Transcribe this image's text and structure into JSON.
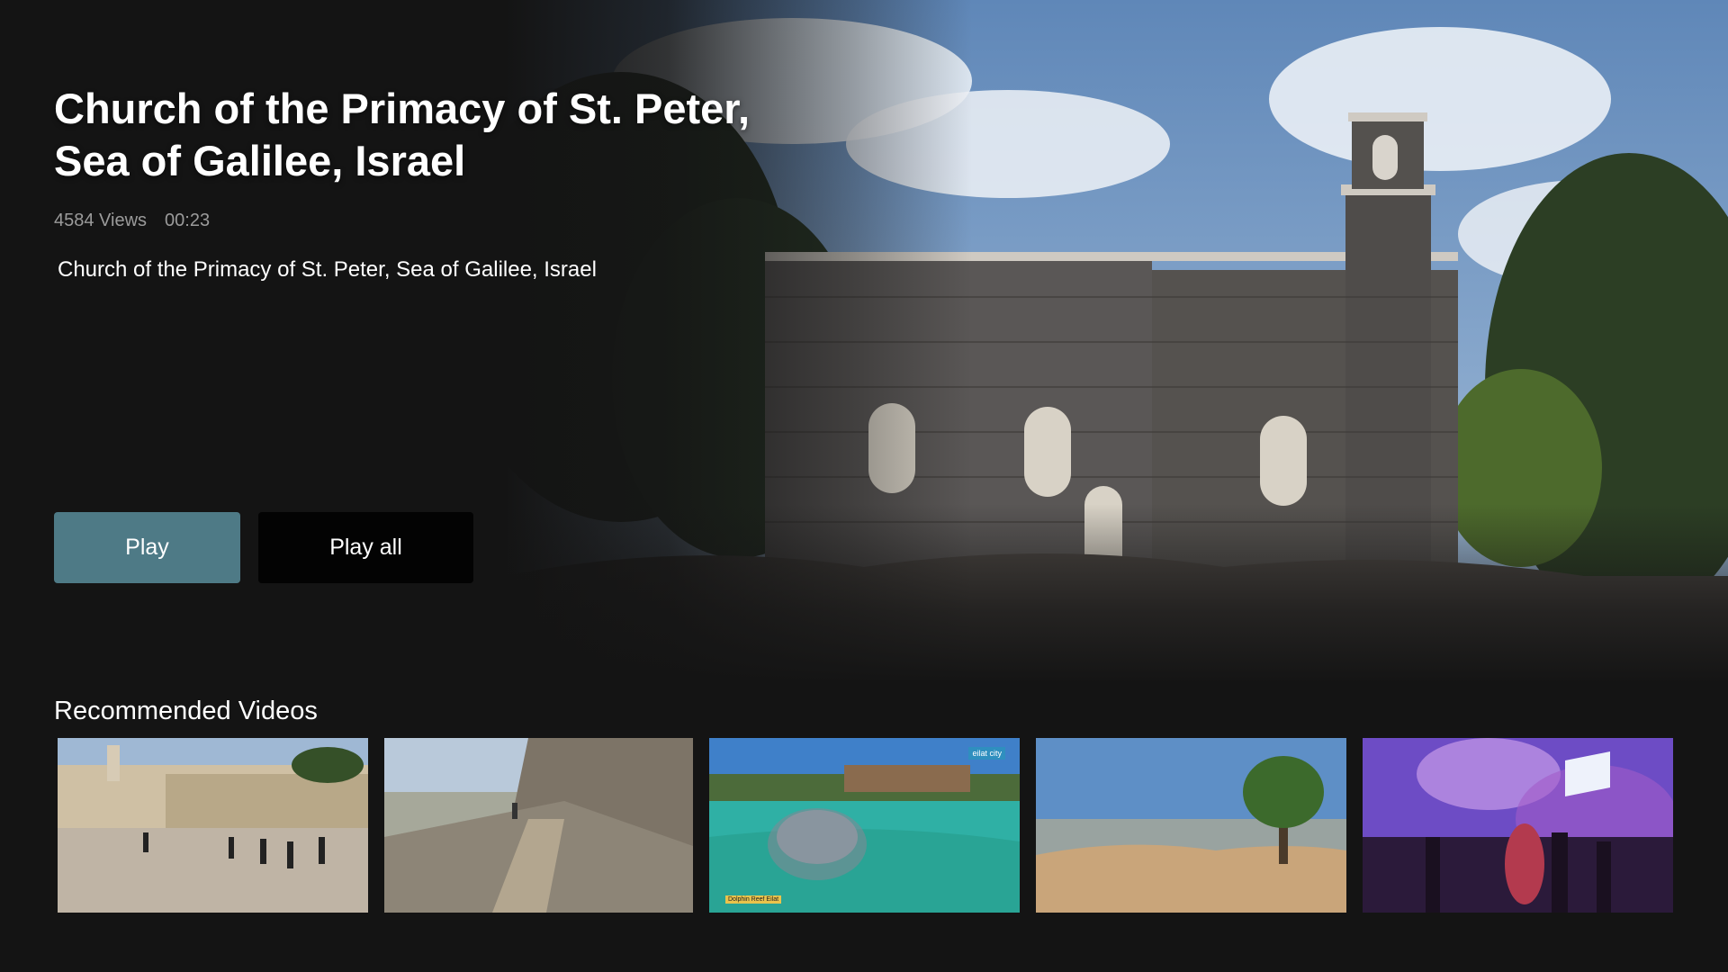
{
  "hero": {
    "title": "Church of the Primacy of St. Peter, Sea of Galilee, Israel",
    "views": "4584 Views",
    "duration": "00:23",
    "description": "Church of the Primacy of St. Peter, Sea of Galilee, Israel",
    "colors": {
      "play_button": "#4e7a86",
      "play_all_button": "#030303",
      "background": "#141414"
    }
  },
  "actions": {
    "play_label": "Play",
    "play_all_label": "Play all"
  },
  "recommended": {
    "heading": "Recommended Videos",
    "items": [
      {
        "scene": "western-wall-plaza-thumbnail"
      },
      {
        "scene": "mountain-trail-thumbnail"
      },
      {
        "scene": "dolphin-reef-thumbnail",
        "tag": "Dolphin Reef Eilat",
        "logo": "eilat city"
      },
      {
        "scene": "rocky-lookout-tree-thumbnail"
      },
      {
        "scene": "concert-flag-crowd-thumbnail"
      }
    ]
  }
}
